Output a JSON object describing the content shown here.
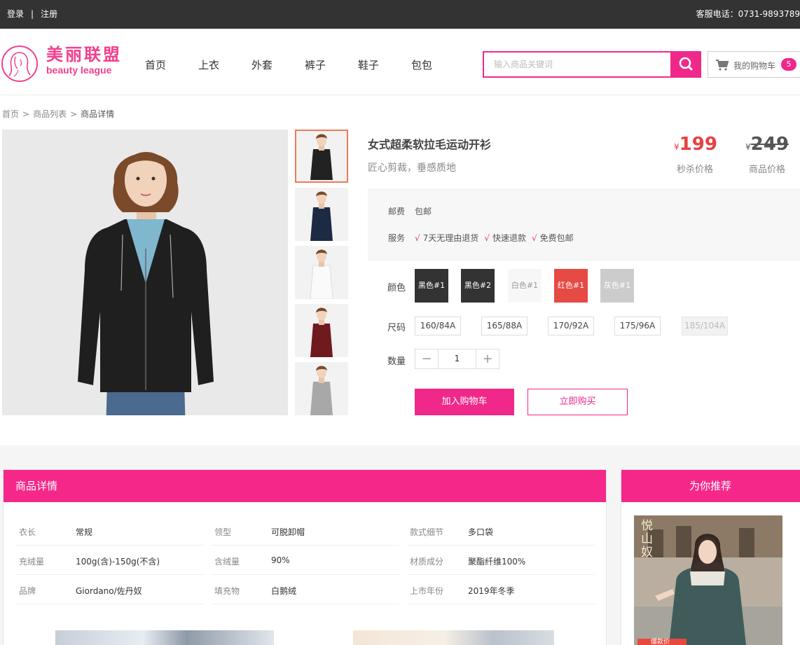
{
  "topbar": {
    "login": "登录",
    "register": "注册",
    "hotline": "客服电话：0731-9893789"
  },
  "logo": {
    "cn": "美丽联盟",
    "en": "beauty  league"
  },
  "nav": [
    "首页",
    "上衣",
    "外套",
    "裤子",
    "鞋子",
    "包包"
  ],
  "search": {
    "placeholder": "输入商品关键词"
  },
  "cart": {
    "label": "我的购物车",
    "count": "5"
  },
  "breadcrumb": {
    "home": "首页",
    "list": "商品列表",
    "current": "商品详情",
    "sep": ">"
  },
  "product": {
    "title": "女式超柔软拉毛运动开衫",
    "subtitle": "匠心剪裁，垂感质地",
    "sale_price": "199",
    "sale_label": "秒杀价格",
    "orig_price": "249",
    "orig_label": "商品价格",
    "currency": "¥"
  },
  "shipping": {
    "label": "邮费",
    "value": "包邮"
  },
  "service": {
    "label": "服务",
    "items": [
      "7天无理由退货",
      "快速退款",
      "免费包邮"
    ],
    "check": "√"
  },
  "colors": {
    "label": "颜色",
    "options": [
      {
        "name": "黑色#1",
        "bg": "#333333",
        "fg": "#ffffff"
      },
      {
        "name": "黑色#2",
        "bg": "#333333",
        "fg": "#ffffff"
      },
      {
        "name": "白色#1",
        "bg": "#f7f7f7",
        "fg": "#999999"
      },
      {
        "name": "红色#1",
        "bg": "#e64a45",
        "fg": "#ffffff"
      },
      {
        "name": "灰色#1",
        "bg": "#cccccc",
        "fg": "#ffffff"
      }
    ]
  },
  "sizes": {
    "label": "尺码",
    "options": [
      "160/84A",
      "165/88A",
      "170/92A",
      "175/96A",
      "185/104A"
    ],
    "disabled": "185/104A"
  },
  "quantity": {
    "label": "数量",
    "value": "1",
    "minus": "−",
    "plus": "+"
  },
  "buttons": {
    "add_to_cart": "加入购物车",
    "buy_now": "立即购买"
  },
  "details": {
    "title": "商品详情",
    "attributes": [
      {
        "k": "衣长",
        "v": "常规"
      },
      {
        "k": "领型",
        "v": "可脱卸帽"
      },
      {
        "k": "款式细节",
        "v": "多口袋"
      },
      {
        "k": "充绒量",
        "v": "100g(含)-150g(不含)"
      },
      {
        "k": "含绒量",
        "v": "90%"
      },
      {
        "k": "材质成分",
        "v": "聚酯纤维100%"
      },
      {
        "k": "品牌",
        "v": "Giordano/佐丹奴"
      },
      {
        "k": "填充物",
        "v": "白鹅绒"
      },
      {
        "k": "上市年份",
        "v": "2019年冬季"
      }
    ]
  },
  "recommend": {
    "title": "为你推荐",
    "banner_text": "悦山奴",
    "tag": "爆款价"
  },
  "theme": {
    "accent": "#f0288a",
    "sale": "#e64242",
    "dark": "#333333"
  }
}
